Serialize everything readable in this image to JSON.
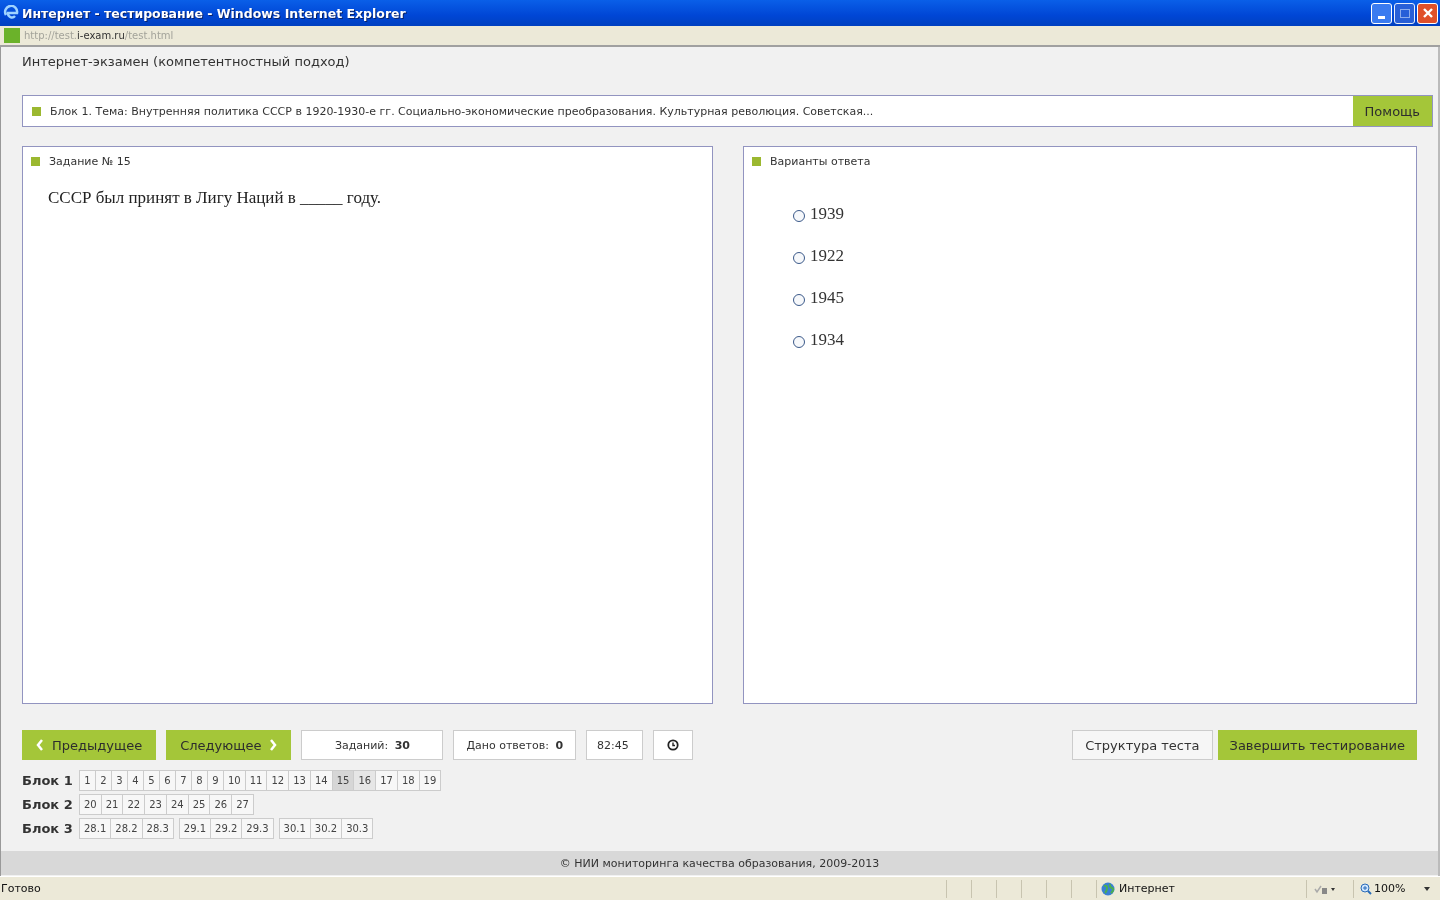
{
  "window": {
    "title": "Интернет - тестирование - Windows Internet Explorer"
  },
  "address": {
    "parts": [
      {
        "text": "http://test.",
        "kind": "faded"
      },
      {
        "text": "i-exam.ru",
        "kind": "host"
      },
      {
        "text": "/test.html",
        "kind": "faded"
      }
    ]
  },
  "page_title": "Интернет-экзамен (компетентностный подход)",
  "topic": {
    "text": "Блок 1. Тема: Внутренняя политика СССР в 1920-1930-е гг. Социально-экономические преобразования. Культурная революция. Советская...",
    "help_button": "Помощь"
  },
  "question": {
    "heading": "Задание № 15",
    "text": "СССР был принят в Лигу Наций в _____ году."
  },
  "answers": {
    "heading": "Варианты ответа",
    "options": [
      {
        "label": "1939",
        "selected": false
      },
      {
        "label": "1922",
        "selected": false
      },
      {
        "label": "1945",
        "selected": false
      },
      {
        "label": "1934",
        "selected": false
      }
    ]
  },
  "toolbar": {
    "prev": "Предыдущее",
    "next": "Следующее",
    "tasks_label": "Заданий:",
    "tasks_value": "30",
    "answered_label": "Дано ответов:",
    "answered_value": "0",
    "timer": "82:45",
    "structure": "Структура теста",
    "finish": "Завершить тестирование"
  },
  "blocks": [
    {
      "label": "Блок 1",
      "groups": [
        [
          {
            "n": "1",
            "selected": false,
            "visited": false
          },
          {
            "n": "2",
            "selected": false,
            "visited": false
          },
          {
            "n": "3",
            "selected": false,
            "visited": false
          },
          {
            "n": "4",
            "selected": false,
            "visited": false
          },
          {
            "n": "5",
            "selected": false,
            "visited": false
          },
          {
            "n": "6",
            "selected": false,
            "visited": false
          },
          {
            "n": "7",
            "selected": false,
            "visited": false
          },
          {
            "n": "8",
            "selected": false,
            "visited": false
          },
          {
            "n": "9",
            "selected": false,
            "visited": false
          },
          {
            "n": "10",
            "selected": false,
            "visited": false
          },
          {
            "n": "11",
            "selected": false,
            "visited": false
          },
          {
            "n": "12",
            "selected": false,
            "visited": false
          },
          {
            "n": "13",
            "selected": false,
            "visited": false
          },
          {
            "n": "14",
            "selected": false,
            "visited": false
          },
          {
            "n": "15",
            "selected": true,
            "visited": true
          },
          {
            "n": "16",
            "selected": false,
            "visited": true
          },
          {
            "n": "17",
            "selected": false,
            "visited": false
          },
          {
            "n": "18",
            "selected": false,
            "visited": false
          },
          {
            "n": "19",
            "selected": false,
            "visited": false
          }
        ]
      ]
    },
    {
      "label": "Блок 2",
      "groups": [
        [
          {
            "n": "20",
            "selected": false,
            "visited": false
          },
          {
            "n": "21",
            "selected": false,
            "visited": false
          },
          {
            "n": "22",
            "selected": false,
            "visited": false
          },
          {
            "n": "23",
            "selected": false,
            "visited": false
          },
          {
            "n": "24",
            "selected": false,
            "visited": false
          },
          {
            "n": "25",
            "selected": false,
            "visited": false
          },
          {
            "n": "26",
            "selected": false,
            "visited": false
          },
          {
            "n": "27",
            "selected": false,
            "visited": false
          }
        ]
      ]
    },
    {
      "label": "Блок 3",
      "groups": [
        [
          {
            "n": "28.1",
            "selected": false,
            "visited": false
          },
          {
            "n": "28.2",
            "selected": false,
            "visited": false
          },
          {
            "n": "28.3",
            "selected": false,
            "visited": false
          }
        ],
        [
          {
            "n": "29.1",
            "selected": false,
            "visited": false
          },
          {
            "n": "29.2",
            "selected": false,
            "visited": false
          },
          {
            "n": "29.3",
            "selected": false,
            "visited": false
          }
        ],
        [
          {
            "n": "30.1",
            "selected": false,
            "visited": false
          },
          {
            "n": "30.2",
            "selected": false,
            "visited": false
          },
          {
            "n": "30.3",
            "selected": false,
            "visited": false
          }
        ]
      ]
    }
  ],
  "footer": "© НИИ мониторинга качества образования, 2009-2013",
  "status_bar": {
    "text": "Готово",
    "zone": "Интернет",
    "zoom": "100%"
  }
}
